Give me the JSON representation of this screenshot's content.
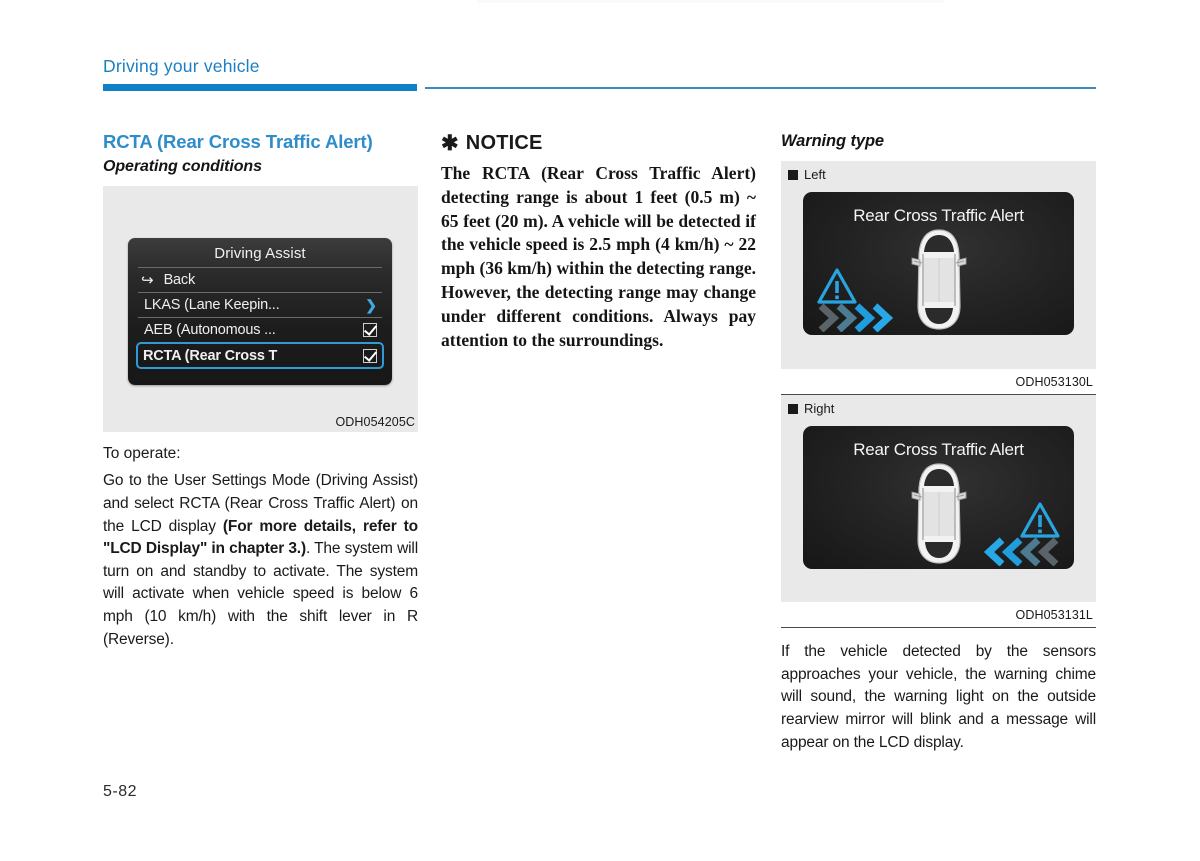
{
  "header": {
    "title": "Driving your vehicle",
    "rule_color": "#0e81c6"
  },
  "page_number": "5-82",
  "left_column": {
    "section_title": "RCTA (Rear Cross Traffic Alert)",
    "subsection_title": "Operating conditions",
    "figure": {
      "caption": "ODH054205C",
      "lcd": {
        "title": "Driving Assist",
        "rows": [
          {
            "label": "Back",
            "icon": "back-arrow-icon",
            "control": "none",
            "selected": false
          },
          {
            "label": "LKAS (Lane Keepin...",
            "icon": "none",
            "control": "chevron-right-icon",
            "selected": false
          },
          {
            "label": "AEB (Autonomous ...",
            "icon": "none",
            "control": "checkbox-checked",
            "selected": false
          },
          {
            "label": "RCTA (Rear Cross T",
            "icon": "none",
            "control": "checkbox-checked",
            "selected": true
          }
        ]
      }
    },
    "to_operate_label": "To operate:",
    "paragraph_part1": "Go to the User Settings Mode (Driving Assist) and select RCTA (Rear Cross Traffic Alert) on the LCD display ",
    "paragraph_bold": "(For more details, refer to \"LCD Display\" in chapter 3.)",
    "paragraph_part2": ". The system will turn on and standby to activate. The system will activate when vehicle speed is below 6 mph (10 km/h) with the shift lever in R (Reverse)."
  },
  "middle_column": {
    "notice_asterisk": "✱",
    "notice_title": "NOTICE",
    "notice_body": "The RCTA (Rear Cross Traffic Alert) detecting range is about 1 feet (0.5 m) ~ 65 feet (20 m). A vehicle will be detected if the vehicle speed is 2.5 mph (4 km/h) ~ 22 mph (36 km/h) within the detecting range. However, the detecting range may change under different conditions. Always pay attention to the surroundings."
  },
  "right_column": {
    "title": "Warning type",
    "figures": [
      {
        "side_label": "Left",
        "screen_title": "Rear Cross Traffic Alert",
        "warning_side": "left",
        "caption": "ODH053130L"
      },
      {
        "side_label": "Right",
        "screen_title": "Rear Cross Traffic Alert",
        "warning_side": "right",
        "caption": "ODH053131L"
      }
    ],
    "paragraph": "If the vehicle detected by the sensors approaches your vehicle, the warning chime will sound, the warning light on the outside rearview mirror will blink and a message will appear on the LCD display."
  },
  "colors": {
    "accent_blue": "#2f8ccb",
    "rule_blue": "#0e81c6",
    "lcd_highlight": "#2e9bd6",
    "warning_cyan": "#29a4e0",
    "figure_bg": "#e9e9e9"
  }
}
